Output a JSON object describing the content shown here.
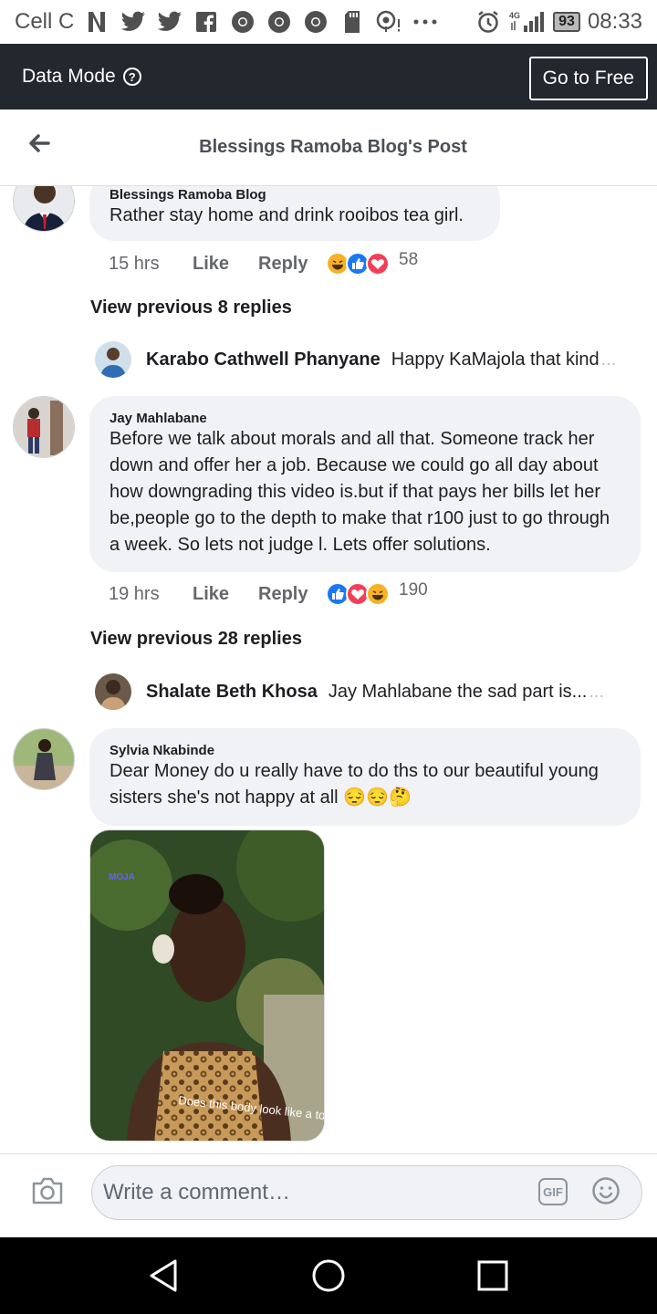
{
  "status_bar": {
    "carrier": "Cell C",
    "battery": "93",
    "time": "08:33",
    "network": "4G"
  },
  "data_bar": {
    "label": "Data Mode",
    "button": "Go to Free"
  },
  "header": {
    "title": "Blessings Ramoba Blog's Post"
  },
  "comments": [
    {
      "author": "Blessings Ramoba Blog",
      "text": "Rather stay home and drink rooibos tea girl.",
      "time": "15 hrs",
      "like": "Like",
      "reply": "Reply",
      "reaction_count": "58"
    },
    {
      "author": "Jay Mahlabane",
      "text": "Before we talk about morals and all that. Someone track her down and offer her a job. Because we could go all day about how downgrading this video is.but if that pays her bills let her be,people go to the depth to make that r100 just to go through a week. So lets not judge l. Lets offer solutions.",
      "time": "19 hrs",
      "like": "Like",
      "reply": "Reply",
      "reaction_count": "190"
    },
    {
      "author": "Sylvia Nkabinde",
      "text": "Dear Money do u really have to do ths to our beautiful young sisters she's not happy at all",
      "emojis": "😔😔🤔",
      "photo_caption": "Does this body look like a to",
      "photo_logo": "MOJA"
    }
  ],
  "view_previous": [
    "View previous 8 replies",
    "View previous 28 replies"
  ],
  "reply_previews": [
    {
      "name": "Karabo Cathwell Phanyane",
      "text": "Happy KaMajola that kind",
      "more": "..."
    },
    {
      "name": "Shalate Beth Khosa",
      "text": "Jay Mahlabane the sad part is...",
      "more": "..."
    }
  ],
  "composer": {
    "placeholder": "Write a comment…",
    "gif_label": "GIF"
  },
  "colors": {
    "data_bar_bg": "#23272e",
    "bubble_bg": "#f0f2f5",
    "like_blue": "#1877f2",
    "love_red": "#f33e58",
    "haha_yellow": "#f7b125"
  }
}
